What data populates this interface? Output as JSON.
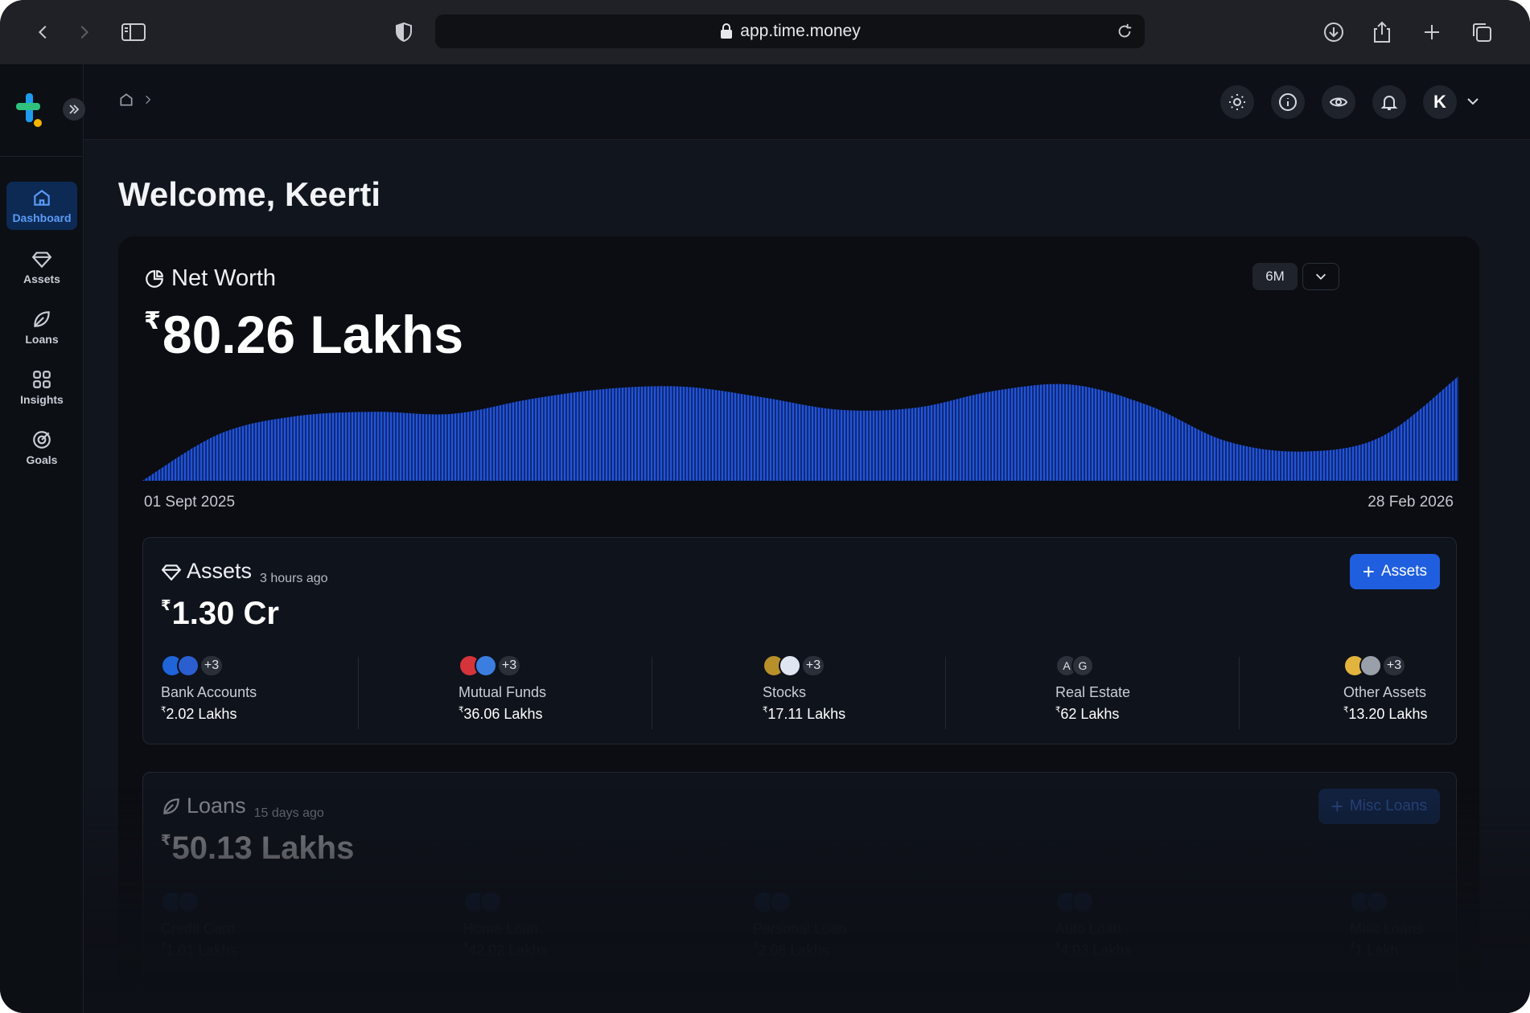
{
  "browser": {
    "url": "app.time.money"
  },
  "sidebar": {
    "items": [
      {
        "label": "Dashboard",
        "icon": "home-icon",
        "active": true
      },
      {
        "label": "Assets",
        "icon": "diamond-icon",
        "active": false
      },
      {
        "label": "Loans",
        "icon": "leaf-icon",
        "active": false
      },
      {
        "label": "Insights",
        "icon": "grid-icon",
        "active": false
      },
      {
        "label": "Goals",
        "icon": "target-icon",
        "active": false
      }
    ]
  },
  "header": {
    "avatar_initial": "K"
  },
  "main": {
    "welcome": "Welcome, Keerti",
    "net_worth": {
      "title": "Net Worth",
      "currency": "₹",
      "value": "80.26 Lakhs",
      "range": "6M",
      "start_date": "01 Sept 2025",
      "end_date": "28 Feb 2026"
    },
    "assets": {
      "title": "Assets",
      "updated": "3 hours ago",
      "currency": "₹",
      "value": "1.30 Cr",
      "add_label": "Assets",
      "categories": [
        {
          "label": "Bank Accounts",
          "value": "2.02 Lakhs",
          "more": "+3"
        },
        {
          "label": "Mutual Funds",
          "value": "36.06 Lakhs",
          "more": "+3"
        },
        {
          "label": "Stocks",
          "value": "17.11 Lakhs",
          "more": "+3"
        },
        {
          "label": "Real Estate",
          "value": "62 Lakhs",
          "initials": [
            "A",
            "G"
          ]
        },
        {
          "label": "Other Assets",
          "value": "13.20 Lakhs",
          "more": "+3"
        }
      ]
    },
    "loans": {
      "title": "Loans",
      "updated": "15 days ago",
      "currency": "₹",
      "value": "50.13 Lakhs",
      "add_label": "Misc Loans",
      "categories": [
        {
          "label": "Credit Card",
          "value": "1.01 Lakhs"
        },
        {
          "label": "Home Loan",
          "value": "42.02 Lakhs"
        },
        {
          "label": "Personal Loan",
          "value": "2.06 Lakhs"
        },
        {
          "label": "Auto Loan",
          "value": "4.03 Lakhs"
        },
        {
          "label": "Misc Loans",
          "value": "1 Lakh"
        }
      ]
    }
  },
  "chart_data": {
    "type": "area",
    "x": [
      "01 Sept 2025",
      "28 Feb 2026"
    ],
    "series": [
      {
        "values": [
          0.0,
          0.45,
          0.62,
          0.66,
          0.64,
          0.78,
          0.88,
          0.9,
          0.8,
          0.68,
          0.7,
          0.86,
          0.92,
          0.72,
          0.38,
          0.28,
          0.42,
          1.0
        ]
      }
    ],
    "color": "#1f4fcf"
  }
}
